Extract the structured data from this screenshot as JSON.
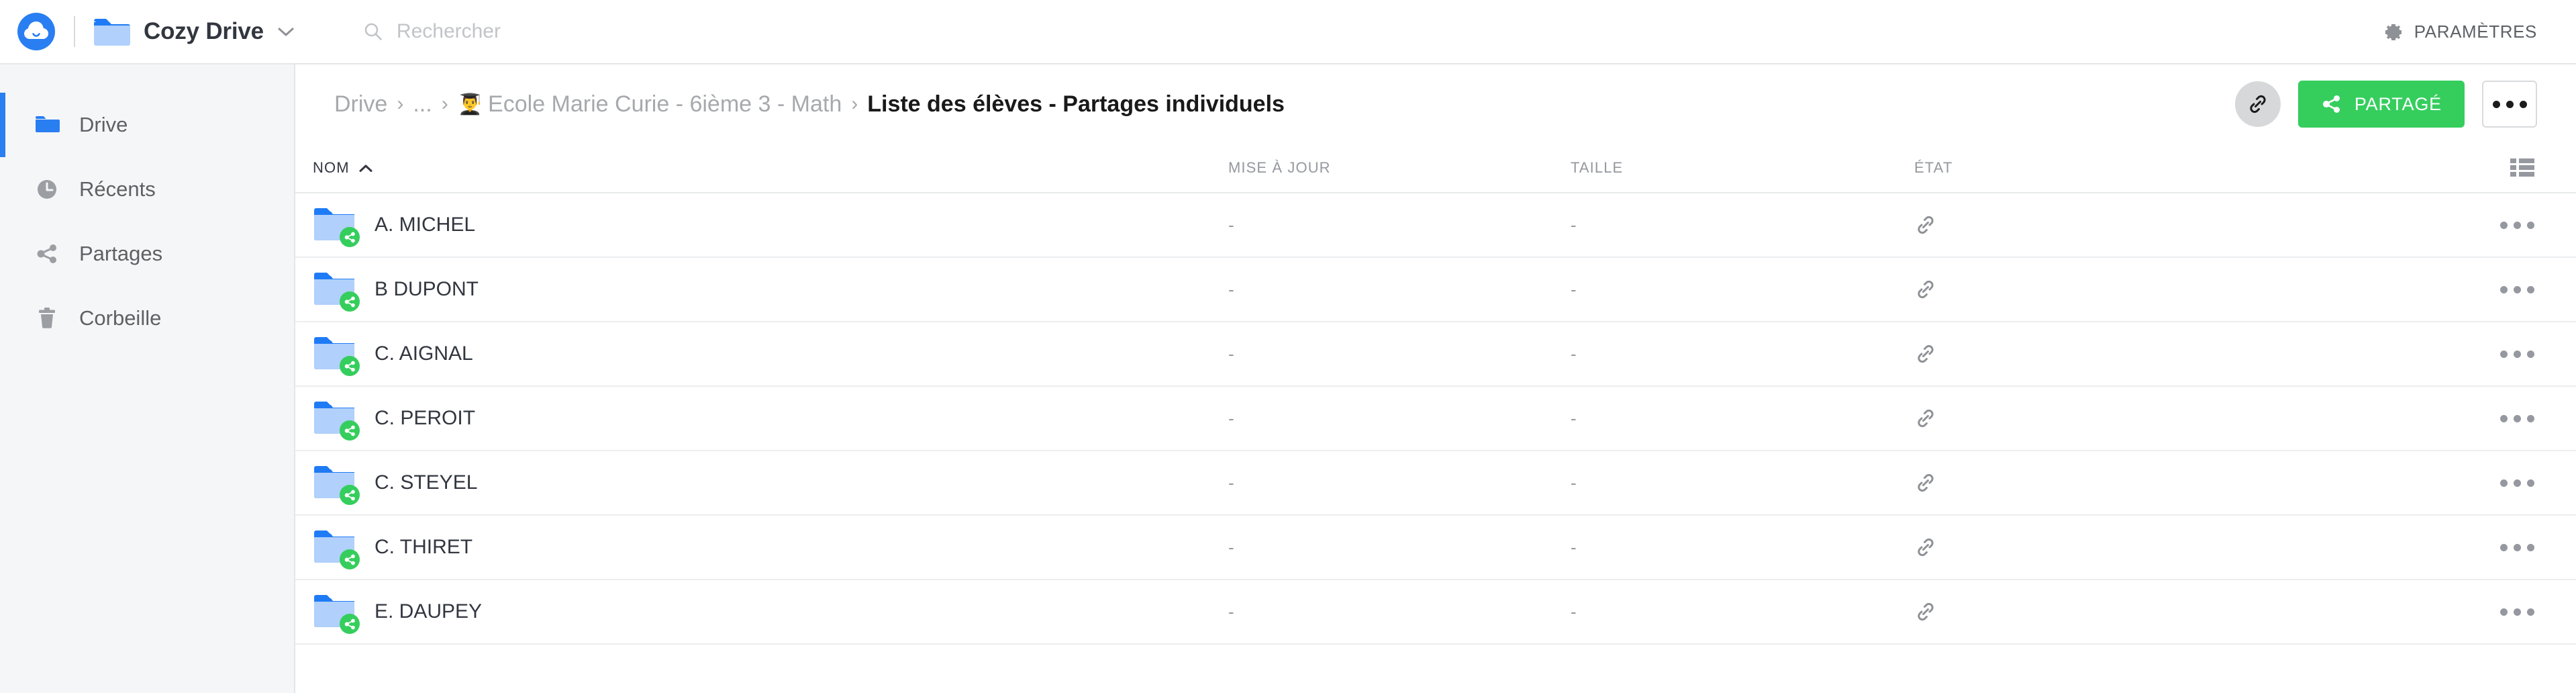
{
  "topbar": {
    "logo_icon": "cozy-cloud-logo",
    "app_icon": "folder-icon",
    "app_name": "Cozy Drive",
    "app_chevron_icon": "chevron-down-icon",
    "search": {
      "icon": "search-icon",
      "placeholder": "Rechercher",
      "value": ""
    },
    "settings": {
      "icon": "gear-icon",
      "label": "PARAMÈTRES"
    }
  },
  "sidebar": {
    "items": [
      {
        "label": "Drive",
        "icon": "folder-icon",
        "active": true
      },
      {
        "label": "Récents",
        "icon": "clock-icon",
        "active": false
      },
      {
        "label": "Partages",
        "icon": "share-icon",
        "active": false
      },
      {
        "label": "Corbeille",
        "icon": "trash-icon",
        "active": false
      }
    ]
  },
  "breadcrumb": {
    "items": [
      {
        "label": "Drive",
        "emoji": ""
      },
      {
        "label": "...",
        "emoji": ""
      },
      {
        "label": "Ecole Marie Curie - 6ième 3 - Math",
        "emoji": "👨‍🎓"
      }
    ],
    "separator": "›",
    "current": "Liste des élèves - Partages individuels"
  },
  "toolbar": {
    "link_icon": "link-icon",
    "share_button": {
      "icon": "share-icon",
      "label": "PARTAGÉ"
    },
    "more_button": {
      "icon": "more-horizontal-icon",
      "label": ""
    }
  },
  "table": {
    "columns": {
      "name": "NOM",
      "updated": "MISE À JOUR",
      "size": "TAILLE",
      "state": "ÉTAT"
    },
    "sort": {
      "column": "NOM",
      "direction": "asc",
      "icon": "caret-up-icon"
    },
    "view_toggle_icon": "list-view-icon",
    "rows": [
      {
        "name": "A. MICHEL",
        "updated": "-",
        "size": "-",
        "state_icon": "link-icon",
        "icon": "folder-shared-icon",
        "actions_icon": "more-horizontal-icon"
      },
      {
        "name": "B DUPONT",
        "updated": "-",
        "size": "-",
        "state_icon": "link-icon",
        "icon": "folder-shared-icon",
        "actions_icon": "more-horizontal-icon"
      },
      {
        "name": "C. AIGNAL",
        "updated": "-",
        "size": "-",
        "state_icon": "link-icon",
        "icon": "folder-shared-icon",
        "actions_icon": "more-horizontal-icon"
      },
      {
        "name": "C. PEROIT",
        "updated": "-",
        "size": "-",
        "state_icon": "link-icon",
        "icon": "folder-shared-icon",
        "actions_icon": "more-horizontal-icon"
      },
      {
        "name": "C. STEYEL",
        "updated": "-",
        "size": "-",
        "state_icon": "link-icon",
        "icon": "folder-shared-icon",
        "actions_icon": "more-horizontal-icon"
      },
      {
        "name": "C. THIRET",
        "updated": "-",
        "size": "-",
        "state_icon": "link-icon",
        "icon": "folder-shared-icon",
        "actions_icon": "more-horizontal-icon"
      },
      {
        "name": "E. DAUPEY",
        "updated": "-",
        "size": "-",
        "state_icon": "link-icon",
        "icon": "folder-shared-icon",
        "actions_icon": "more-horizontal-icon"
      }
    ]
  },
  "colors": {
    "accent_blue": "#297ef2",
    "share_green": "#35ce5d",
    "folder_light": "#b1d0fb",
    "folder_tab": "#1f7bf5",
    "text_dark": "#32363f",
    "text_muted": "#95989e",
    "sidebar_bg": "#f5f6f7"
  }
}
